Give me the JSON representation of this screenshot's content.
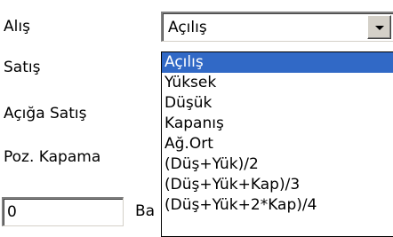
{
  "form": {
    "labels": {
      "alis": "Alış",
      "satis": "Satış",
      "aciga_satis": "Açığa Satış",
      "poz_kapama": "Poz. Kapama"
    },
    "combo": {
      "value": "Açılış",
      "button_icon": "chevron-down-icon"
    },
    "dropdown": {
      "options": [
        "Açılış",
        "Yüksek",
        "Düşük",
        "Kapanış",
        "Ağ.Ort",
        "(Düş+Yük)/2",
        "(Düş+Yük+Kap)/3",
        "(Düş+Yük+2*Kap)/4"
      ],
      "selected_index": 0
    },
    "input": {
      "value": "0"
    },
    "partial_label": "Ba"
  },
  "colors": {
    "selection_bg": "#3169c6",
    "selection_fg": "#ffffff",
    "face": "#d4d0c8"
  }
}
